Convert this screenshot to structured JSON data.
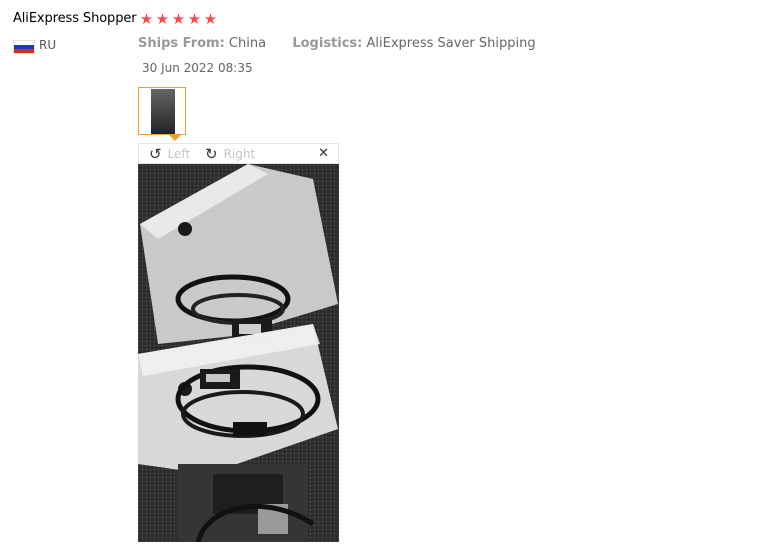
{
  "review": {
    "user_name": "AliExpress Shopper",
    "rating": 5,
    "stars": [
      "★",
      "★",
      "★",
      "★",
      "★"
    ],
    "country_code": "RU",
    "ships_from_label": "Ships From:",
    "ships_from_value": "China",
    "logistics_label": "Logistics:",
    "logistics_value": "AliExpress Saver Shipping",
    "date": "30 Jun 2022 08:35"
  },
  "viewer": {
    "rotate_left_icon": "rotate-ccw-icon",
    "rotate_left_glyph": "↺",
    "rotate_left_label": "Left",
    "rotate_right_icon": "rotate-cw-icon",
    "rotate_right_glyph": "↻",
    "rotate_right_label": "Right",
    "close_icon": "close-icon",
    "close_glyph": "✕"
  },
  "colors": {
    "star": "#f24e4e",
    "thumbnail_border": "#f0a030",
    "flag": [
      "#ffffff",
      "#1c3fa8",
      "#d52b1e"
    ]
  }
}
